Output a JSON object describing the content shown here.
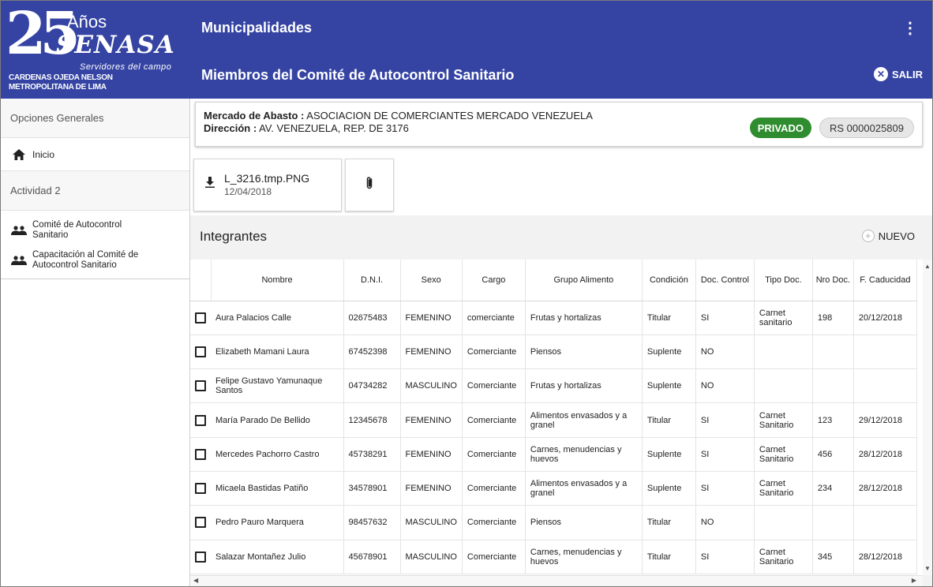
{
  "brand": {
    "logo_number": "25",
    "logo_anos": "Años",
    "logo_name": "SENASA",
    "logo_tagline": "Servidores del campo",
    "user_name": "CARDENAS OJEDA NELSON",
    "user_org": "METROPOLITANA DE LIMA",
    "primary_color": "#3544a3"
  },
  "sidebar": {
    "section1": "Opciones Generales",
    "inicio": "Inicio",
    "section2": "Actividad 2",
    "items": [
      {
        "label": "Comité de Autocontrol Sanitario",
        "icon": "people-icon"
      },
      {
        "label": "Capacitación al Comité de Autocontrol Sanitario",
        "icon": "people-icon"
      }
    ]
  },
  "header": {
    "title": "Municipalidades",
    "subtitle": "Miembros del Comité de Autocontrol Sanitario",
    "salir": "SALIR",
    "menu_icon": "kebab-menu-icon"
  },
  "info": {
    "mercado_label": "Mercado de Abasto :",
    "mercado_value": "ASOCIACION DE COMERCIANTES MERCADO VENEZUELA",
    "direccion_label": "Dirección :",
    "direccion_value": "AV. VENEZUELA, REP. DE 3176",
    "tipo_badge": "PRIVADO",
    "rs_badge": "RS 0000025809",
    "tipo_color": "#2f8d2f"
  },
  "file": {
    "name": "L_3216.tmp.PNG",
    "date": "12/04/2018"
  },
  "panel": {
    "title": "Integrantes",
    "nuevo": "NUEVO"
  },
  "table": {
    "headers": [
      "Nombre",
      "D.N.I.",
      "Sexo",
      "Cargo",
      "Grupo Alimento",
      "Condición",
      "Doc. Control",
      "Tipo Doc.",
      "Nro Doc.",
      "F. Caducidad"
    ],
    "rows": [
      [
        "Aura Palacios Calle",
        "02675483",
        "FEMENINO",
        "comerciante",
        "Frutas y hortalizas",
        "Titular",
        "SI",
        "Carnet sanitario",
        "198",
        "20/12/2018"
      ],
      [
        "Elizabeth Mamani Laura",
        "67452398",
        "FEMENINO",
        "Comerciante",
        "Piensos",
        "Suplente",
        "NO",
        "",
        "",
        ""
      ],
      [
        "Felipe Gustavo Yamunaque Santos",
        "04734282",
        "MASCULINO",
        "Comerciante",
        "Frutas y hortalizas",
        "Suplente",
        "NO",
        "",
        "",
        ""
      ],
      [
        "María Parado De Bellido",
        "12345678",
        "FEMENINO",
        "Comerciante",
        "Alimentos envasados y a granel",
        "Titular",
        "SI",
        "Carnet Sanitario",
        "123",
        "29/12/2018"
      ],
      [
        "Mercedes Pachorro Castro",
        "45738291",
        "FEMENINO",
        "Comerciante",
        "Carnes, menudencias y huevos",
        "Suplente",
        "SI",
        "Carnet Sanitario",
        "456",
        "28/12/2018"
      ],
      [
        "Micaela Bastidas Patiño",
        "34578901",
        "FEMENINO",
        "Comerciante",
        "Alimentos envasados y a granel",
        "Suplente",
        "SI",
        "Carnet Sanitario",
        "234",
        "28/12/2018"
      ],
      [
        "Pedro Pauro Marquera",
        "98457632",
        "MASCULINO",
        "Comerciante",
        "Piensos",
        "Titular",
        "NO",
        "",
        "",
        ""
      ],
      [
        "Salazar Montañez Julio",
        "45678901",
        "MASCULINO",
        "Comerciante",
        "Carnes, menudencias y huevos",
        "Titular",
        "SI",
        "Carnet Sanitario",
        "345",
        "28/12/2018"
      ]
    ]
  }
}
